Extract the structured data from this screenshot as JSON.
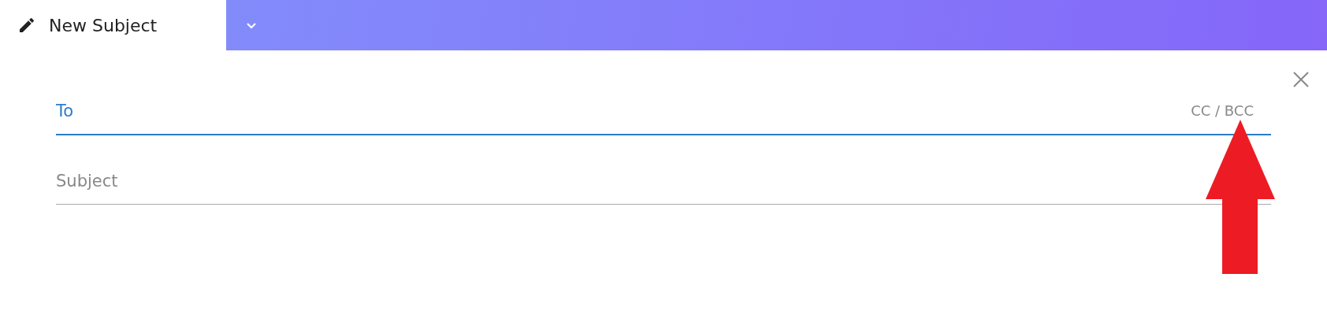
{
  "tab": {
    "title": "New Subject"
  },
  "fields": [
    {
      "placeholder": "To",
      "focused": true,
      "link": "CC / BCC"
    },
    {
      "placeholder": "Subject",
      "focused": false
    }
  ]
}
